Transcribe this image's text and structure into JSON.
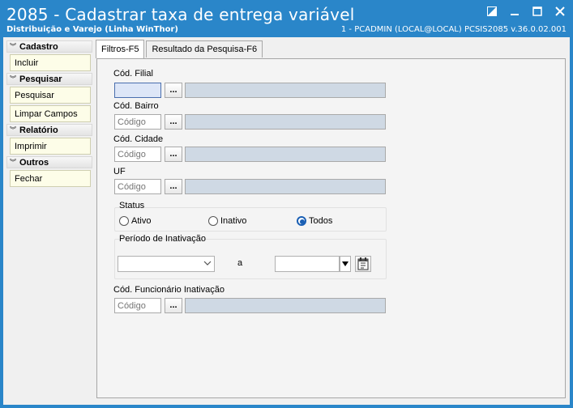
{
  "window": {
    "title": "2085 - Cadastrar taxa de entrega variável",
    "subtitle": "Distribuição e Varejo (Linha WinThor)",
    "user_info": "1 - PCADMIN (LOCAL@LOCAL)   PCSIS2085  v.36.0.02.001"
  },
  "sidebar": {
    "groups": [
      {
        "title": "Cadastro",
        "items": [
          "Incluir"
        ]
      },
      {
        "title": "Pesquisar",
        "items": [
          "Pesquisar",
          "Limpar Campos"
        ]
      },
      {
        "title": "Relatório",
        "items": [
          "Imprimir"
        ]
      },
      {
        "title": "Outros",
        "items": [
          "Fechar"
        ]
      }
    ]
  },
  "tabs": [
    {
      "label": "Filtros-F5",
      "active": true
    },
    {
      "label": "Resultado da Pesquisa-F6",
      "active": false
    }
  ],
  "filters": {
    "cod_filial": {
      "label": "Cód. Filial",
      "value": "",
      "placeholder": ""
    },
    "cod_bairro": {
      "label": "Cód. Bairro",
      "value": "",
      "placeholder": "Código"
    },
    "cod_cidade": {
      "label": "Cód. Cidade",
      "value": "",
      "placeholder": "Código"
    },
    "uf": {
      "label": "UF",
      "value": "",
      "placeholder": "Código"
    },
    "lookup_label": "...",
    "status": {
      "label": "Status",
      "options": [
        "Ativo",
        "Inativo",
        "Todos"
      ],
      "selected": "Todos"
    },
    "periodo": {
      "label": "Período de Inativação",
      "separator": "a",
      "start": "",
      "end": ""
    },
    "cod_funcionario": {
      "label": "Cód. Funcionário Inativação",
      "value": "",
      "placeholder": "Código"
    }
  },
  "colors": {
    "titlebar": "#2a86c9",
    "desc_field": "#cfd9e4",
    "sidebar_item": "#fdfde8",
    "radio_selected": "#1a5fb4"
  }
}
